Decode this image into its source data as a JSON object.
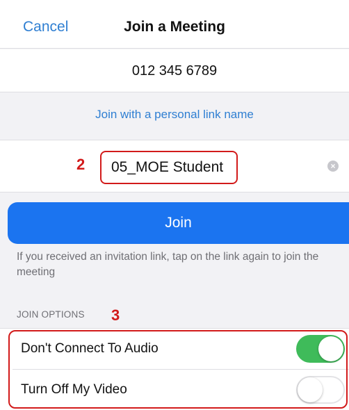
{
  "header": {
    "cancel_label": "Cancel",
    "title": "Join a Meeting"
  },
  "meeting": {
    "id": "012 345 6789",
    "personal_link_label": "Join with a personal link name"
  },
  "name_field": {
    "value": "05_MOE Student",
    "clear_icon": "clear-circle-icon"
  },
  "annotations": {
    "step2": "2",
    "step3": "3"
  },
  "join_button_label": "Join",
  "info_text": "If you received an invitation link, tap on the link again to join the meeting",
  "join_options": {
    "section_label": "JOIN OPTIONS",
    "items": [
      {
        "label": "Don't Connect To Audio",
        "enabled": true
      },
      {
        "label": "Turn Off My Video",
        "enabled": false
      }
    ]
  },
  "colors": {
    "link_blue": "#2f7fd2",
    "button_blue": "#1b74f0",
    "toggle_green": "#3fbb5a",
    "annotation_red": "#d21a1a"
  }
}
